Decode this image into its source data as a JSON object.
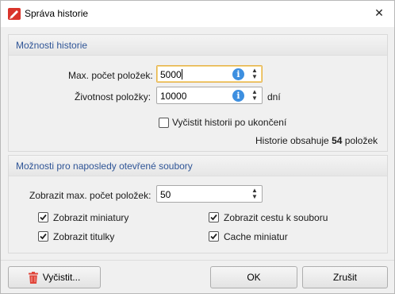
{
  "window": {
    "title": "Správa historie",
    "close_symbol": "✕",
    "app_icon": "foxit-phantom-icon"
  },
  "history_options": {
    "header": "Možnosti historie",
    "max_items_label": "Max. počet položek:",
    "max_items_value": "5000",
    "lifetime_label": "Životnost položky:",
    "lifetime_value": "10000",
    "lifetime_unit": "dní",
    "clear_on_exit_label": "Vyčistit historii po ukončení",
    "clear_on_exit_checked": false,
    "summary_prefix": "Historie obsahuje",
    "summary_count": "54",
    "summary_suffix": "položek"
  },
  "recent_files": {
    "header": "Možnosti pro naposledy otevřené soubory",
    "show_max_label": "Zobrazit max. počet položek:",
    "show_max_value": "50",
    "checkboxes": [
      {
        "label": "Zobrazit miniatury",
        "checked": true
      },
      {
        "label": "Zobrazit cestu k souboru",
        "checked": true
      },
      {
        "label": "Zobrazit titulky",
        "checked": true
      },
      {
        "label": "Cache miniatur",
        "checked": true
      }
    ]
  },
  "footer": {
    "clear_label": "Vyčistit...",
    "ok_label": "OK",
    "cancel_label": "Zrušit"
  },
  "colors": {
    "group_header_text": "#2f5597",
    "focus_border": "#e6b24a",
    "info_icon": "#3d8fe0",
    "trash_icon": "#e0453a",
    "app_icon": "#d9342b"
  }
}
